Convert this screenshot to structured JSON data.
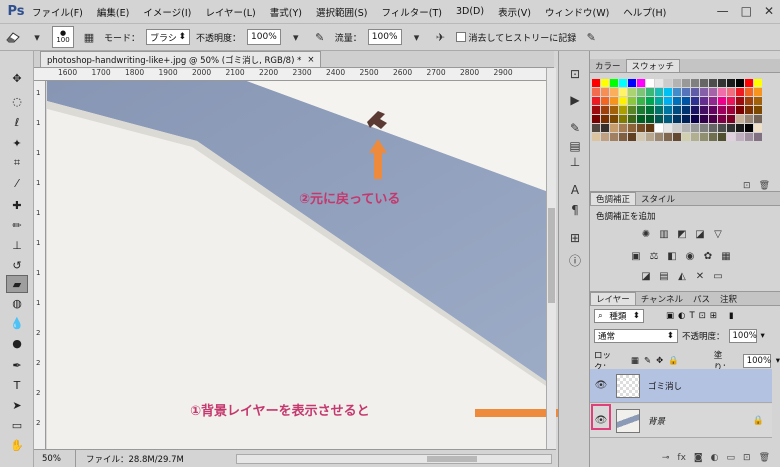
{
  "app": {
    "logo": "Ps",
    "menu": [
      "ファイル(F)",
      "編集(E)",
      "イメージ(I)",
      "レイヤー(L)",
      "書式(Y)",
      "選択範囲(S)",
      "フィルター(T)",
      "3D(D)",
      "表示(V)",
      "ウィンドウ(W)",
      "ヘルプ(H)"
    ],
    "window_controls": [
      "—",
      "□",
      "✕"
    ]
  },
  "options": {
    "brush_size": "100",
    "mode_label": "モード：",
    "mode_value": "ブラシ",
    "opacity_label": "不透明度：",
    "opacity_value": "100%",
    "flow_label": "流量：",
    "flow_value": "100%",
    "history_label": "消去してヒストリーに記録"
  },
  "document": {
    "tab_title": "photoshop-handwriting-like+.jpg @ 50% (ゴミ消し, RGB/8) *",
    "tab_close": "×",
    "ruler_top": [
      "1600",
      "1700",
      "1800",
      "1900",
      "2000",
      "2100",
      "2200",
      "2300",
      "2400",
      "2500",
      "2600",
      "2700",
      "2800",
      "2900"
    ],
    "ruler_left": [
      "1",
      "1",
      "1",
      "1",
      "1",
      "1",
      "1",
      "1",
      "2",
      "2",
      "2",
      "2"
    ],
    "zoom": "50%",
    "file_info": "ファイル：28.8M/29.7M"
  },
  "annotations": {
    "top": "②元に戻っている",
    "bottom": "①背景レイヤーを表示させると"
  },
  "panels": {
    "swatch_tabs": [
      "カラー",
      "スウォッチ"
    ],
    "adj_tabs": [
      "色調補正",
      "スタイル"
    ],
    "adj_title": "色調補正を追加",
    "layer_tabs": [
      "レイヤー",
      "チャンネル",
      "パス",
      "注釈"
    ],
    "kind_label": "種類",
    "blend_mode": "通常",
    "opacity_label": "不透明度：",
    "opacity_value": "100%",
    "lock_label": "ロック：",
    "fill_label": "塗り：",
    "fill_value": "100%",
    "layers": [
      {
        "name": "ゴミ消し"
      },
      {
        "name": "背景"
      }
    ]
  },
  "colors": {
    "accent_annotation": "#c4386e",
    "arrow": "#ee8a3c",
    "sky": "#8b9bb7",
    "wall": "#f3f2ef",
    "layer_selected": "#b4c2e2"
  }
}
